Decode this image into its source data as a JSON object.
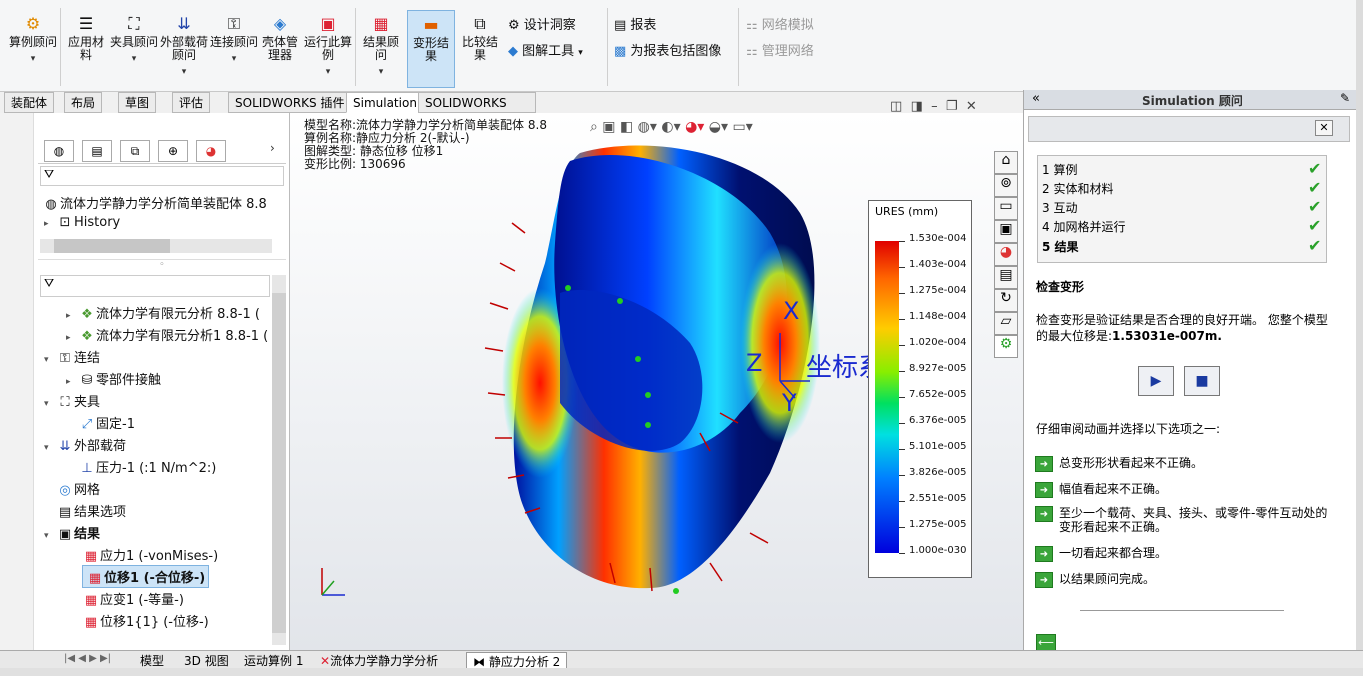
{
  "ribbon": {
    "buttons": [
      "算例顾问",
      "应用材料",
      "夹具顾问",
      "外部载荷顾问",
      "连接顾问",
      "壳体管理器",
      "运行此算例",
      "结果顾问",
      "变形结果",
      "比较结果"
    ],
    "small_mid": [
      "设计洞察",
      "图解工具"
    ],
    "small_report": [
      "报表",
      "为报表包括图像"
    ],
    "small_net": [
      "网络模拟",
      "管理网络"
    ]
  },
  "tabs": [
    "装配体",
    "布局",
    "草图",
    "评估",
    "SOLIDWORKS 插件",
    "Simulation",
    "SOLIDWORKS MBD"
  ],
  "feature_tree": {
    "assembly": "流体力学静力学分析简单装配体",
    "assembly_suffix": "8.8",
    "history": "History",
    "items": [
      {
        "label": "流体力学有限元分析  8.8-1 ("
      },
      {
        "label": "流体力学有限元分析1  8.8-1 ("
      },
      {
        "label": "连结"
      },
      {
        "label": "零部件接触"
      },
      {
        "label": "夹具"
      },
      {
        "label": "固定-1"
      },
      {
        "label": "外部载荷"
      },
      {
        "label": "压力-1 (:1 N/m^2:)"
      },
      {
        "label": "网格"
      },
      {
        "label": "结果选项"
      },
      {
        "label": "结果"
      },
      {
        "label": "应力1 (-vonMises-)"
      },
      {
        "label": "位移1 (-合位移-)"
      },
      {
        "label": "应变1 (-等量-)"
      },
      {
        "label": "位移1{1} (-位移-)"
      }
    ]
  },
  "viewport": {
    "model_name": "模型名称:流体力学静力学分析简单装配体",
    "model_suffix": "8.8",
    "study_name": "算例名称:静应力分析 2(-默认-)",
    "plot_type": "图解类型: 静态位移 位移1",
    "deform_scale": "变形比例: 130696",
    "coord_label": "坐标系2",
    "axis_x": "X",
    "axis_y": "Y",
    "axis_z": "Z"
  },
  "legend": {
    "title": "URES (mm)",
    "values": [
      "1.530e-004",
      "1.403e-004",
      "1.275e-004",
      "1.148e-004",
      "1.020e-004",
      "8.927e-005",
      "7.652e-005",
      "6.376e-005",
      "5.101e-005",
      "3.826e-005",
      "2.551e-005",
      "1.275e-005",
      "1.000e-030"
    ]
  },
  "advisor": {
    "title": "Simulation 顾问",
    "steps": [
      "1 算例",
      "2 实体和材料",
      "3 互动",
      "4 加网格并运行",
      "5 结果"
    ],
    "heading": "检查变形",
    "para1": "检查变形是验证结果是否合理的良好开端。 您整个模型的最大位移是:",
    "max_disp": "1.53031e-007m.",
    "prompt": "仔细审阅动画并选择以下选项之一:",
    "options": [
      "总变形形状看起来不正确。",
      "幅值看起来不正确。",
      "至少一个载荷、夹具、接头、或零件-零件互动处的变形看起来不正确。",
      "一切看起来都合理。",
      "以结果顾问完成。"
    ]
  },
  "bottom_tabs": [
    "模型",
    "3D 视图",
    "运动算例 1",
    "流体力学静力学分析",
    "静应力分析 2"
  ],
  "colors": {
    "accent": "#2aa12a",
    "selection": "#cde4f7"
  }
}
